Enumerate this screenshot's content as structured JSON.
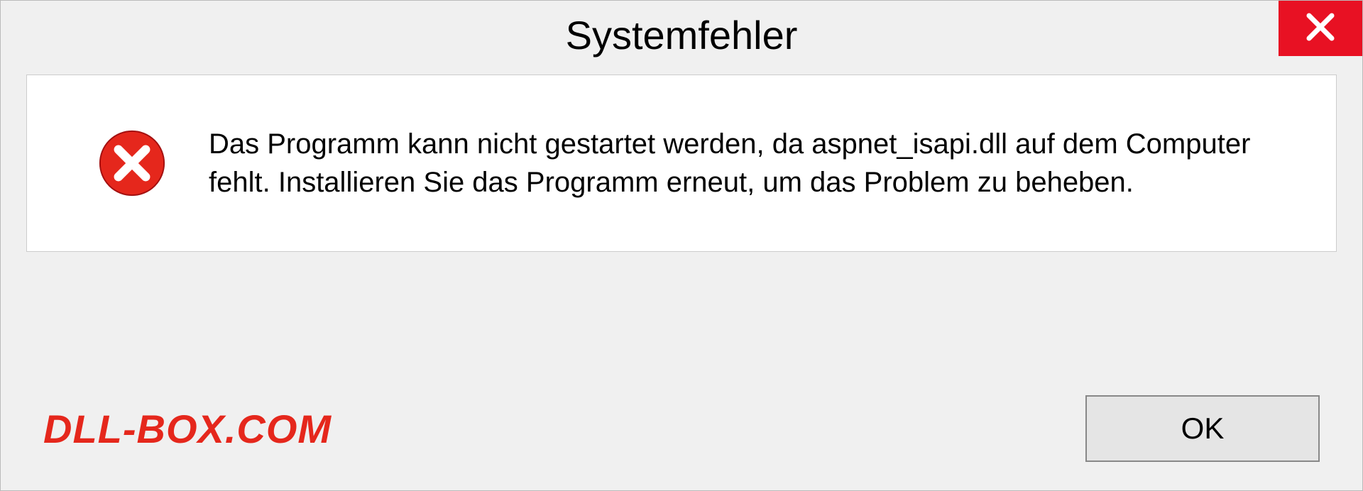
{
  "dialog": {
    "title": "Systemfehler",
    "message": "Das Programm kann nicht gestartet werden, da aspnet_isapi.dll auf dem Computer fehlt. Installieren Sie das Programm erneut, um das Problem zu beheben.",
    "ok_label": "OK"
  },
  "watermark": "DLL-BOX.COM"
}
